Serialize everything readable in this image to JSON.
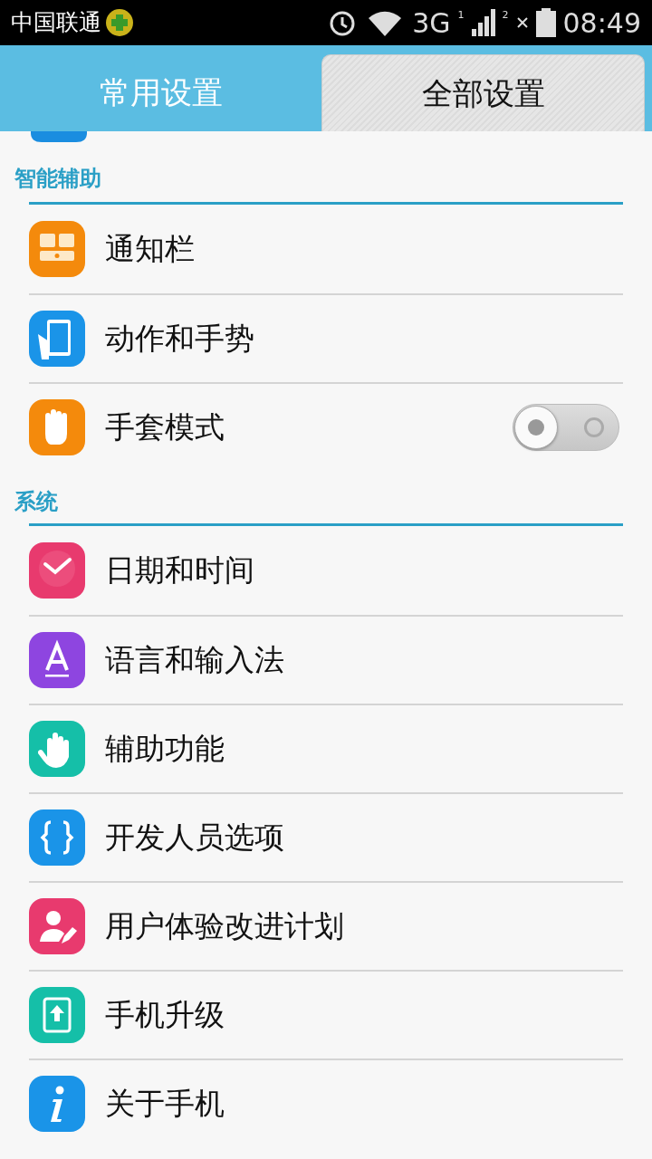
{
  "status_bar": {
    "carrier": "中国联通",
    "network": "3G",
    "sim1": "1",
    "sim2": "2",
    "time": "08:49"
  },
  "tabs": [
    {
      "label": "常用设置",
      "selected": false
    },
    {
      "label": "全部设置",
      "selected": true
    }
  ],
  "sections": [
    {
      "title": "智能辅助",
      "items": [
        {
          "label": "通知栏",
          "kind": "link"
        },
        {
          "label": "动作和手势",
          "kind": "link"
        },
        {
          "label": "手套模式",
          "kind": "switch",
          "on": false
        }
      ]
    },
    {
      "title": "系统",
      "items": [
        {
          "label": "日期和时间",
          "kind": "link"
        },
        {
          "label": "语言和输入法",
          "kind": "link"
        },
        {
          "label": "辅助功能",
          "kind": "link"
        },
        {
          "label": "开发人员选项",
          "kind": "link"
        },
        {
          "label": "用户体验改进计划",
          "kind": "link"
        },
        {
          "label": "手机升级",
          "kind": "link"
        },
        {
          "label": "关于手机",
          "kind": "link"
        }
      ]
    }
  ]
}
